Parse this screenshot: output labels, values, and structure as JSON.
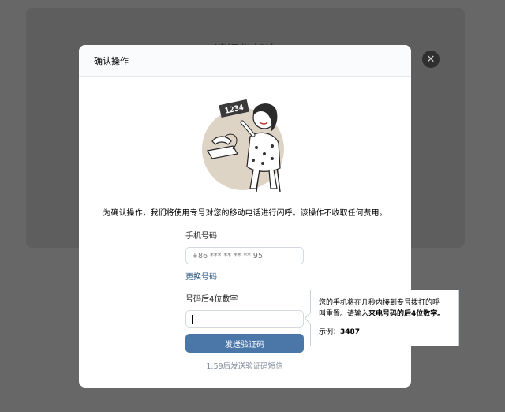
{
  "background": {
    "title": "请提供邮箱"
  },
  "modal": {
    "title": "确认操作",
    "close_icon": "close-icon",
    "illustration": {
      "card_number": "1234"
    },
    "description": "为确认操作，我们将使用专号对您的移动电话进行闪呼。该操作不收取任何费用。",
    "phone": {
      "label": "手机号码",
      "value": "+86 *** ** ** ** 95"
    },
    "change_number": "更换号码",
    "code": {
      "label": "号码后4位数字",
      "value": ""
    },
    "send_button": "发送验证码",
    "timer_text": "1:59后发送验证码短信"
  },
  "tooltip": {
    "line1": "您的手机将在几秒内接到专号拨打的呼",
    "line2_prefix": "叫重置。请输入",
    "line2_bold": "来电号码的后4位数字。",
    "example_label": "示例：",
    "example_value": "3487"
  },
  "colors": {
    "accent": "#4a76a8",
    "link": "#2a5885",
    "overlay": "#676767"
  }
}
